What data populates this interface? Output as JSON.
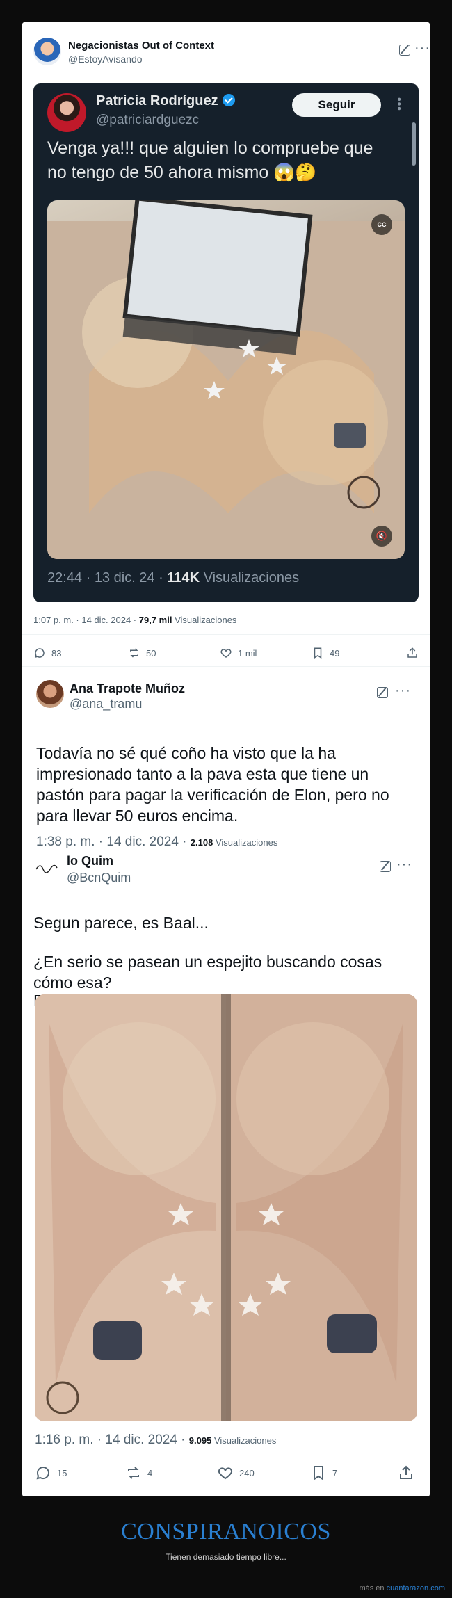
{
  "post": {
    "account_name": "Negacionistas Out of Context",
    "account_handle": "@EstoyAvisando",
    "date": "1:07 p. m. · 14 dic. 2024 · ",
    "views": "79,7 mil",
    "views_label": " Visualizaciones",
    "counts": {
      "replies": "83",
      "reposts": "50",
      "likes": "1 mil",
      "bookmarks": "49"
    }
  },
  "embedded": {
    "name": "Patricia Rodríguez",
    "handle": "@patriciardguezc",
    "follow_label": "Seguir",
    "text": "Venga ya!!! que alguien lo compruebe que no tengo de 50 ahora mismo 😱🤔",
    "cc_label": "CC",
    "meta_prefix": "22:44 · 13 dic. 24 · ",
    "meta_views": "114K",
    "meta_suffix": " Visualizaciones"
  },
  "reply1": {
    "name": "Ana Trapote Muñoz",
    "handle": "@ana_tramu",
    "text": "Todavía no sé qué coño ha visto que la ha impresionado tanto a la pava esta que tiene un pastón para pagar la verificación de Elon, pero no para llevar 50 euros encima.",
    "date": "1:38 p. m. · 14 dic. 2024 · ",
    "views": "2.108",
    "views_label": " Visualizaciones"
  },
  "reply2": {
    "name": "lo Quim",
    "handle": "@BcnQuim",
    "text1": "Segun parece, es Baal...",
    "text2": "¿En serio se pasean un espejito buscando cosas cómo esa?",
    "text3": "Están peor que fatal.",
    "date": "1:16 p. m. · 14 dic. 2024 · ",
    "views": "9.095",
    "views_label": " Visualizaciones",
    "counts": {
      "replies": "15",
      "reposts": "4",
      "likes": "240",
      "bookmarks": "7"
    }
  },
  "footer": {
    "title": "CONSPIRANOICOS",
    "subtitle": "Tienen demasiado tiempo libre...",
    "credit_prefix": "más en ",
    "credit_site": "cuantarazon.com"
  },
  "colors": {
    "brand_blue": "#2a7fd0",
    "verified": "#1d9bf0",
    "dark_card": "#15202b"
  }
}
